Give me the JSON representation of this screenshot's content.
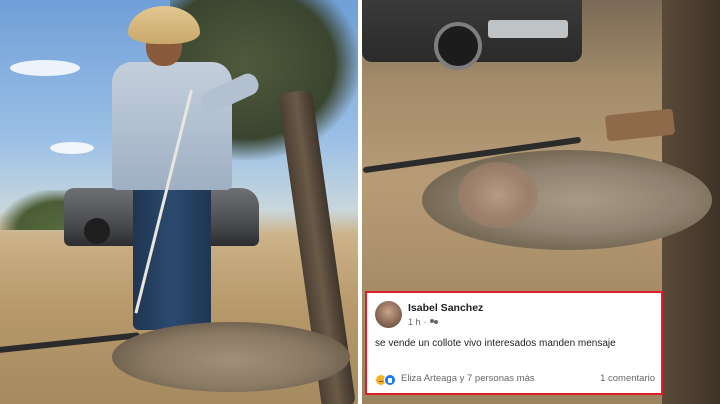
{
  "post": {
    "author": "Isabel Sanchez",
    "time": "1 h",
    "separator": "·",
    "audience_icon": "friends-icon",
    "text": "se vende un collote  vivo interesados manden mensaje",
    "reactions": [
      "sad-reaction",
      "like-reaction"
    ],
    "reactors": "Eliza Arteaga y 7 personas más",
    "comments": "1 comentario"
  },
  "colors": {
    "card_border": "#e11d2a",
    "like_blue": "#1877f2",
    "sad_yellow": "#f7b125",
    "meta_text": "#65676b"
  }
}
